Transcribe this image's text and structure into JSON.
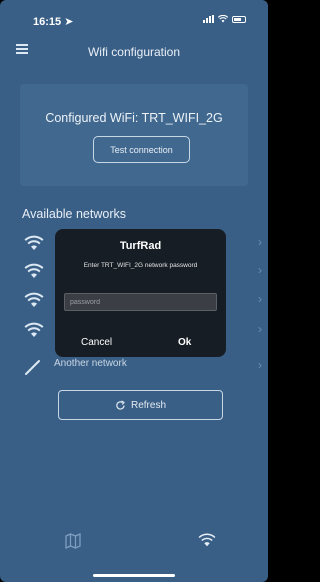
{
  "status_bar": {
    "time": "16:15"
  },
  "header": {
    "title": "Wifi configuration"
  },
  "config": {
    "text": "Configured WiFi: TRT_WIFI_2G",
    "test_button": "Test connection"
  },
  "networks": {
    "title": "Available networks",
    "another": "Another network"
  },
  "refresh": {
    "label": "Refresh"
  },
  "dialog": {
    "title": "TurfRad",
    "message": "Enter TRT_WIFI_2G network password",
    "placeholder": "password",
    "cancel": "Cancel",
    "ok": "Ok"
  },
  "icons": [
    "menu-icon",
    "wifi-icon",
    "pen-icon",
    "refresh-icon",
    "map-icon",
    "chevron-right-icon"
  ]
}
